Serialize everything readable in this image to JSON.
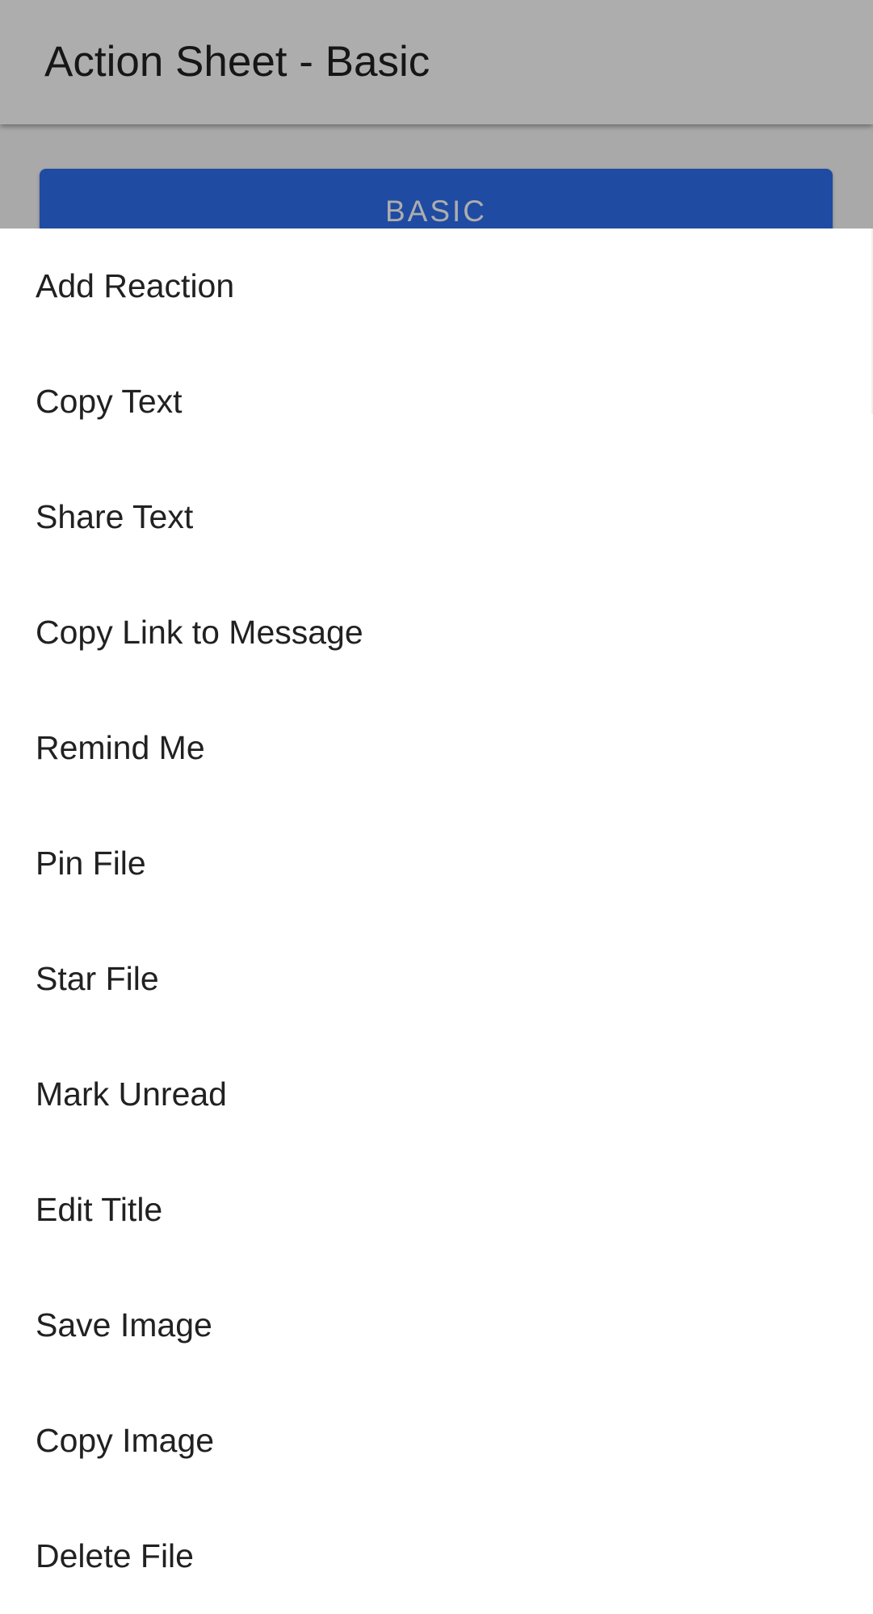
{
  "app_bar": {
    "title": "Action Sheet - Basic"
  },
  "content": {
    "basic_button_label": "BASIC"
  },
  "action_sheet": {
    "items": [
      {
        "label": "Add Reaction"
      },
      {
        "label": "Copy Text"
      },
      {
        "label": "Share Text"
      },
      {
        "label": "Copy Link to Message"
      },
      {
        "label": "Remind Me"
      },
      {
        "label": "Pin File"
      },
      {
        "label": "Star File"
      },
      {
        "label": "Mark Unread"
      },
      {
        "label": "Edit Title"
      },
      {
        "label": "Save Image"
      },
      {
        "label": "Copy Image"
      },
      {
        "label": "Delete File"
      }
    ]
  },
  "colors": {
    "button_blue": "#2f6ff0",
    "scrim": "rgba(0,0,0,0.32)",
    "sheet_background": "#ffffff",
    "text_primary": "#212121"
  }
}
